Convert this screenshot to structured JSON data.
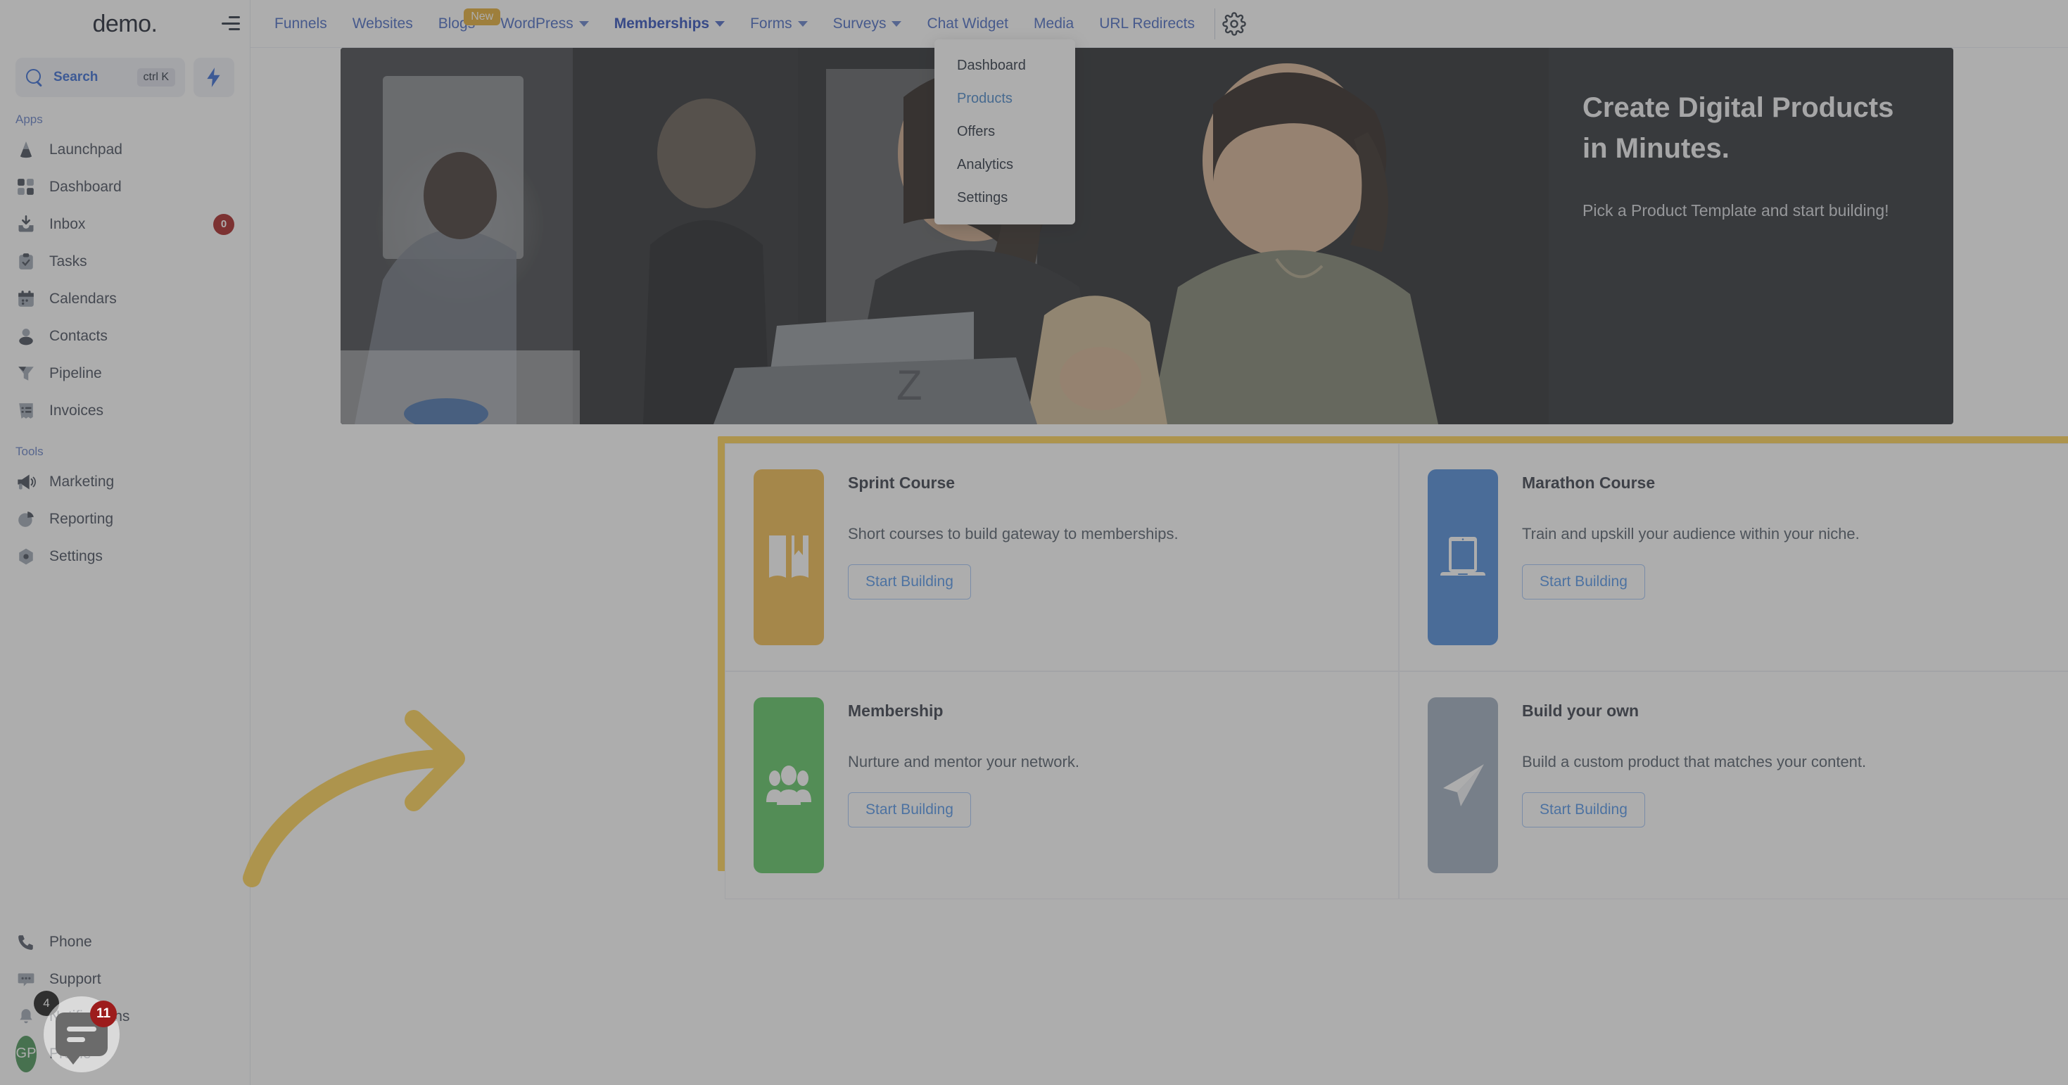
{
  "sidebar": {
    "brand": "demo",
    "brand_dot": ".",
    "collapse_icon": "collapse-sidebar-icon",
    "search": {
      "label": "Search",
      "shortcut": "ctrl K",
      "placeholder": "Search"
    },
    "quick_action_icon": "lightning-bolt-icon",
    "sections": [
      {
        "label": "Apps",
        "items": [
          {
            "label": "Launchpad",
            "icon": "rocket-icon",
            "badge": null
          },
          {
            "label": "Dashboard",
            "icon": "grid-icon",
            "badge": null
          },
          {
            "label": "Inbox",
            "icon": "inbox-icon",
            "badge": "0"
          },
          {
            "label": "Tasks",
            "icon": "clipboard-check-icon",
            "badge": null
          },
          {
            "label": "Calendars",
            "icon": "calendar-icon",
            "badge": null
          },
          {
            "label": "Contacts",
            "icon": "person-icon",
            "badge": null
          },
          {
            "label": "Pipeline",
            "icon": "funnel-icon",
            "badge": null
          },
          {
            "label": "Invoices",
            "icon": "invoice-list-icon",
            "badge": null
          }
        ]
      },
      {
        "label": "Tools",
        "items": [
          {
            "label": "Marketing",
            "icon": "megaphone-icon",
            "badge": null
          },
          {
            "label": "Reporting",
            "icon": "pie-chart-icon",
            "badge": null
          },
          {
            "label": "Settings",
            "icon": "gear-hex-icon",
            "badge": null
          }
        ]
      }
    ],
    "bottom_items": [
      {
        "label": "Phone",
        "icon": "phone-icon",
        "badge": null
      },
      {
        "label": "Support",
        "icon": "chat-dots-icon",
        "badge": null
      },
      {
        "label": "Notifications",
        "icon": "bell-icon",
        "badge": "4"
      },
      {
        "label": "Profile",
        "icon": "avatar-icon",
        "badge": null
      }
    ],
    "profile_initials": "GP",
    "chat_widget": {
      "icon": "chat-bubble-icon",
      "badge": "11"
    }
  },
  "topnav": {
    "items": [
      {
        "label": "Funnels",
        "caret": false,
        "badge": null,
        "active": false
      },
      {
        "label": "Websites",
        "caret": false,
        "badge": null,
        "active": false
      },
      {
        "label": "Blogs",
        "caret": false,
        "badge": "New",
        "active": false
      },
      {
        "label": "WordPress",
        "caret": true,
        "badge": null,
        "active": false
      },
      {
        "label": "Memberships",
        "caret": true,
        "badge": null,
        "active": true
      },
      {
        "label": "Forms",
        "caret": true,
        "badge": null,
        "active": false
      },
      {
        "label": "Surveys",
        "caret": true,
        "badge": null,
        "active": false
      },
      {
        "label": "Chat Widget",
        "caret": false,
        "badge": null,
        "active": false
      },
      {
        "label": "Media",
        "caret": false,
        "badge": null,
        "active": false
      },
      {
        "label": "URL Redirects",
        "caret": false,
        "badge": null,
        "active": false
      }
    ],
    "settings_icon": "gear-icon"
  },
  "dropdown": {
    "open_for": "Memberships",
    "items": [
      {
        "label": "Dashboard",
        "selected": false
      },
      {
        "label": "Products",
        "selected": true
      },
      {
        "label": "Offers",
        "selected": false
      },
      {
        "label": "Analytics",
        "selected": false
      },
      {
        "label": "Settings",
        "selected": false
      }
    ]
  },
  "hero": {
    "title": "Create Digital Products in Minutes.",
    "subtitle": "Pick a Product Template and start building!",
    "image_alt": "two-women-smiling-at-laptop-photo"
  },
  "product_cards": [
    {
      "title": "Sprint Course",
      "description": "Short courses to build gateway to memberships.",
      "button": "Start Building",
      "icon": "open-book-bookmark-icon",
      "icon_bg": "#f0b844"
    },
    {
      "title": "Marathon Course",
      "description": "Train and upskill your audience within your niche.",
      "button": "Start Building",
      "icon": "laptop-icon",
      "icon_bg": "#4484d8"
    },
    {
      "title": "Membership",
      "description": "Nurture and mentor your network.",
      "button": "Start Building",
      "icon": "people-group-icon",
      "icon_bg": "#56c濃"
    },
    {
      "title": "Build your own",
      "description": "Build a custom product that matches your content.",
      "button": "Start Building",
      "icon": "paper-plane-icon",
      "icon_bg": "#9aa8bb"
    }
  ],
  "annotation": {
    "arrow_icon": "curved-arrow-right-icon",
    "highlight_color": "#ffd04a",
    "arrow_color": "#ffd04a"
  },
  "colors": {
    "accent_blue": "#3f62c0",
    "link_blue": "#4a90e8",
    "highlight_yellow": "#ffd04a",
    "badge_red": "#a31717",
    "green": "#56c25b"
  }
}
